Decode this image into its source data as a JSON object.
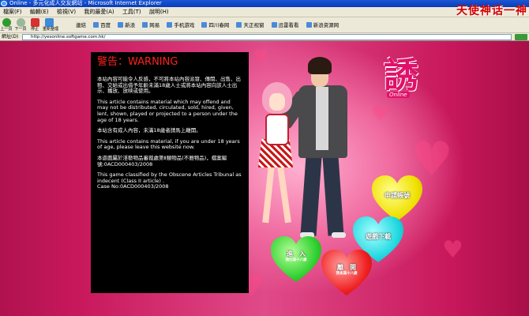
{
  "window": {
    "title": "Online - 多元化成人交友網站 - Microsoft Internet Explorer"
  },
  "menu": {
    "items": [
      "檔案(F)",
      "編輯(E)",
      "檢視(V)",
      "我的最愛(A)",
      "工具(T)",
      "說明(H)"
    ]
  },
  "brand": {
    "text": "天使神话一神"
  },
  "toolbar": {
    "back_label": "上一頁",
    "forward_label": "下一頁",
    "stop_label": "停止",
    "refresh_label": "重新整理",
    "links_label": "連結",
    "links": [
      "百度",
      "新浪",
      "网易",
      "手机游戏",
      "四川春网",
      "天正视窗",
      "迅雷看看",
      "新浪资源网"
    ]
  },
  "address": {
    "label": "網址(D)",
    "url": "http://yesonline.softgame.com.hk/"
  },
  "warning": {
    "title": "警告：WARNING",
    "p1": "本站內容可能令人反感，不可將本站內容派發、傳閱、出售、出租、交給或出借予年齡未滿18歲人士或將本站內容向該人士出示、播放、放映或使用。",
    "p2": "This article contains material which may offend and may not be distributed, circulated, sold, hired, given, lent, shown, played or projected to a person under the age of 18 years.",
    "p3": "本站含有成人內容，未滿18歲者請馬上離開。",
    "p4": "This article contains material, if you are under 18 years of age, please leave this website now.",
    "p5": "本遊戲屬於淫褻物品審裁處第Ⅱ類物品(不雅物品)，檔案編號:0ACD000403/2008",
    "p6": "This game classified by the Obscene Articles Tribunal as indecent (Class II article) .",
    "p7": "Case No:0ACD000403/2008"
  },
  "logo": {
    "char": "誘",
    "sub": "Online"
  },
  "buttons": {
    "register": {
      "l1": "申請帳號",
      "l2": ""
    },
    "download": {
      "l1": "遊戲下載",
      "l2": ""
    },
    "enter": {
      "l1": "進　入",
      "l2": "我已滿十八歲"
    },
    "leave": {
      "l1": "離　開",
      "l2": "我未滿十八歲"
    }
  },
  "colors": {
    "warning_title": "#ff2020",
    "page_bg": "#c8185c",
    "logo": "#e0106a"
  }
}
